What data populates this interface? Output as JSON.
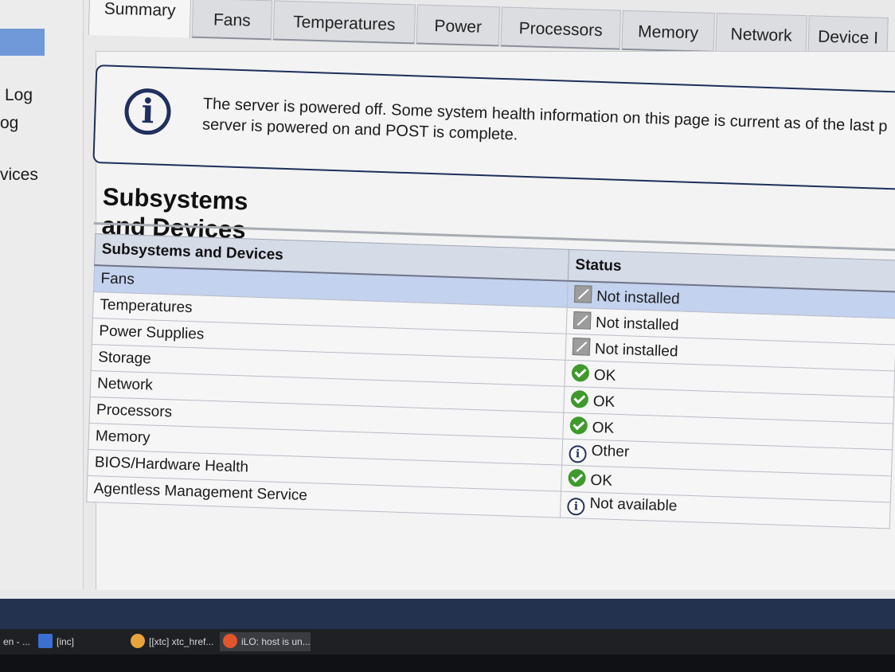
{
  "sidebar": {
    "items": [
      {
        "label": "Log"
      },
      {
        "label": "og"
      },
      {
        "label": "vices"
      }
    ]
  },
  "tabs": [
    {
      "label": "Summary",
      "active": true
    },
    {
      "label": "Fans"
    },
    {
      "label": "Temperatures"
    },
    {
      "label": "Power"
    },
    {
      "label": "Processors"
    },
    {
      "label": "Memory"
    },
    {
      "label": "Network"
    },
    {
      "label": "Device I"
    }
  ],
  "notice": {
    "line1": "The server is powered off. Some system health information on this page is current as of the last p",
    "line2": "server is powered on and POST is complete."
  },
  "section": {
    "title": "Subsystems and Devices"
  },
  "table": {
    "headers": [
      "Subsystems and Devices",
      "Status"
    ],
    "rows": [
      {
        "name": "Fans",
        "status": "Not installed",
        "icon": "not-installed-icon"
      },
      {
        "name": "Temperatures",
        "status": "Not installed",
        "icon": "not-installed-icon"
      },
      {
        "name": "Power Supplies",
        "status": "Not installed",
        "icon": "not-installed-icon"
      },
      {
        "name": "Storage",
        "status": "OK",
        "icon": "ok-check-icon"
      },
      {
        "name": "Network",
        "status": "OK",
        "icon": "ok-check-icon"
      },
      {
        "name": "Processors",
        "status": "OK",
        "icon": "ok-check-icon"
      },
      {
        "name": "Memory",
        "status": "Other",
        "icon": "info-icon"
      },
      {
        "name": "BIOS/Hardware Health",
        "status": "OK",
        "icon": "ok-check-icon"
      },
      {
        "name": "Agentless Management Service",
        "status": "Not available",
        "icon": "info-icon"
      }
    ]
  },
  "taskbar": {
    "items": [
      {
        "label": "en - ..."
      },
      {
        "label": "[inc]"
      },
      {
        "label": "[[xtc] xtc_href..."
      },
      {
        "label": "iLO: host is un..."
      }
    ]
  },
  "colors": {
    "selected_row": "#c3d2ee",
    "ok_green": "#3d9a2b",
    "info_navy": "#1f2f5e",
    "sidebar_selected": "#6f99d8"
  }
}
